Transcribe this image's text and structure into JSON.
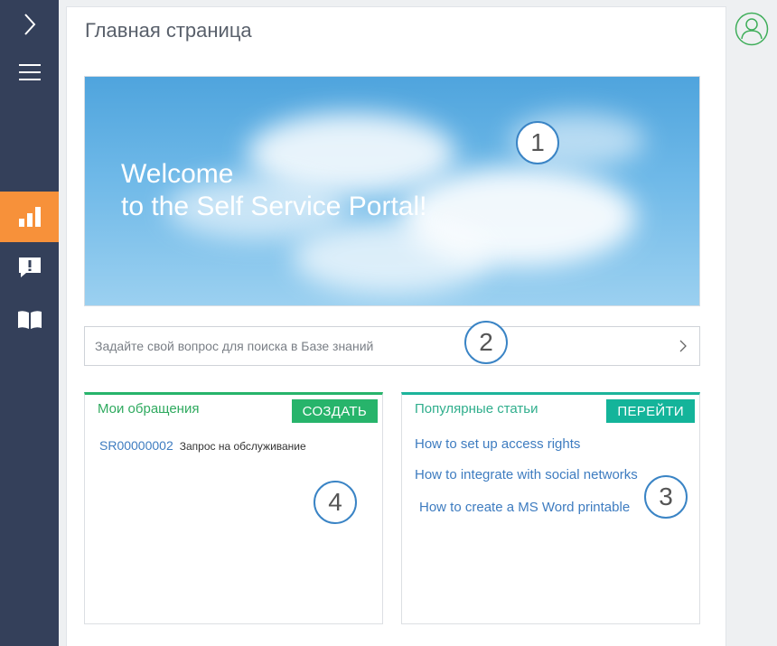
{
  "sidebar": {
    "expand_icon": "chevron-right-icon",
    "menu_icon": "hamburger-icon",
    "items": [
      {
        "icon": "bar-chart-icon",
        "active": true
      },
      {
        "icon": "alert-chat-icon",
        "active": false
      },
      {
        "icon": "open-book-icon",
        "active": false
      }
    ],
    "active_color": "#f7913a",
    "bg_color": "#34405a"
  },
  "header": {
    "title": "Главная страница"
  },
  "banner": {
    "line1": "Welcome",
    "line2": "to the Self Service Portal!"
  },
  "search": {
    "placeholder": "Задайте свой вопрос для поиска в Базе знаний",
    "arrow_icon": "chevron-right-icon"
  },
  "cases_widget": {
    "title": "Мои обращения",
    "button_label": "СОЗДАТЬ",
    "cases": [
      {
        "id": "SR00000002",
        "subject": "Запрос на обслуживание"
      }
    ]
  },
  "articles_widget": {
    "title": "Популярные статьи",
    "button_label": "ПЕРЕЙТИ",
    "articles": [
      "How to set up access rights",
      "How to integrate with social networks",
      "How to create a MS Word printable"
    ]
  },
  "callouts": [
    "1",
    "2",
    "3",
    "4"
  ],
  "user": {
    "avatar_icon": "user-avatar-icon"
  }
}
